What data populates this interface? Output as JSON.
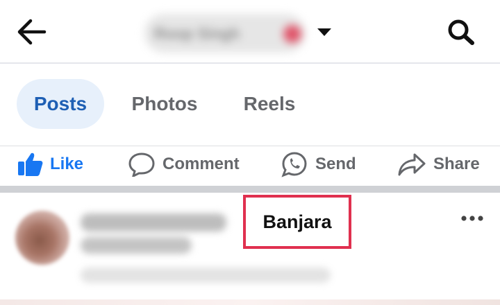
{
  "header": {
    "profile_name": "Roop Singh",
    "back_icon": "arrow-left-icon",
    "caret_icon": "caret-down-icon",
    "search_icon": "search-icon"
  },
  "tabs": [
    {
      "label": "Posts",
      "active": true
    },
    {
      "label": "Photos",
      "active": false
    },
    {
      "label": "Reels",
      "active": false
    }
  ],
  "actions": {
    "like": "Like",
    "comment": "Comment",
    "send": "Send",
    "share": "Share"
  },
  "post": {
    "highlight_label": "Banjara",
    "more_icon": "more-horizontal-icon"
  },
  "colors": {
    "accent": "#1877f2",
    "active_tab_bg": "#e7f0fb",
    "active_tab_text": "#1e5fb4",
    "muted_text": "#65676b",
    "highlight_border": "#e0304f"
  }
}
